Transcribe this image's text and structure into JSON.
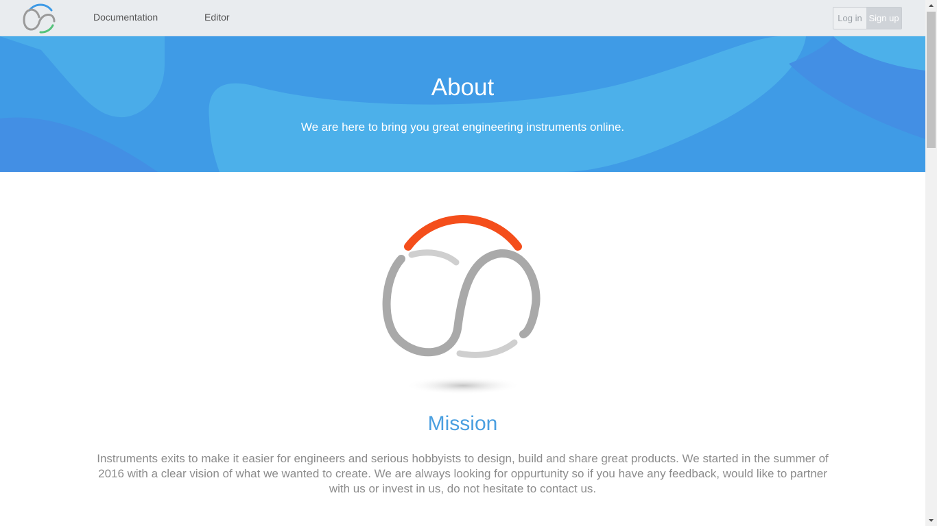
{
  "navbar": {
    "links": [
      {
        "label": "Documentation"
      },
      {
        "label": "Editor"
      }
    ],
    "login_label": "Log in",
    "signup_label": "Sign up"
  },
  "hero": {
    "title": "About",
    "subtitle": "We are here to bring you great engineering instruments online."
  },
  "mission": {
    "title": "Mission",
    "text": "Instruments exits to make it easier for engineers and serious hobbyists to design, build and share great products. We started in the summer of 2016 with a clear vision of what we wanted to create. We are always looking for oppurtunity so if you have any feedback, would like to partner with us or invest in us, do not hesitate to contact us."
  },
  "colors": {
    "hero_blue": "#3d9ae6",
    "hero_light": "#4cb0ea",
    "accent_orange": "#f44e1b",
    "mission_blue": "#4a9fe0",
    "logo_grey": "#a9a9a9"
  }
}
